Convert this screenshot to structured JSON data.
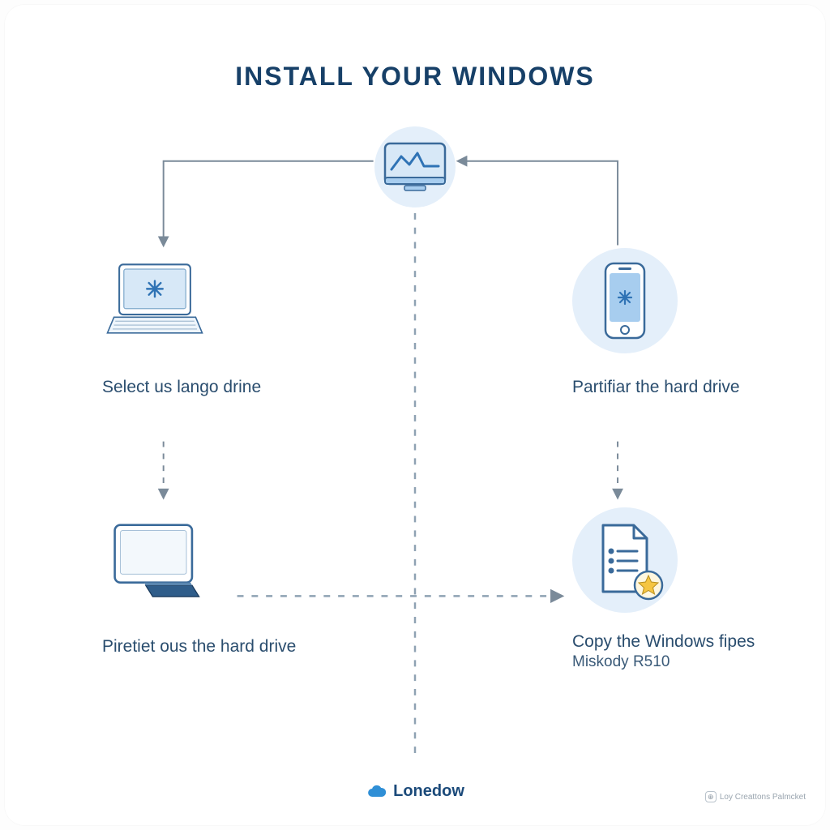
{
  "title": "INSTALL YOUR WINDOWS",
  "nodes": {
    "top": {
      "icon": "monitor-graph-icon"
    },
    "left": {
      "icon": "laptop-icon",
      "caption": "Select us lango drine"
    },
    "right": {
      "icon": "phone-icon",
      "caption": "Partifiar the hard drive"
    },
    "bl": {
      "icon": "tablet-icon",
      "caption": "Piretiet ous the hard drive"
    },
    "br": {
      "icon": "file-star-icon",
      "caption": "Copy the Windows fipes",
      "sub": "Miskody R510"
    }
  },
  "brand": {
    "name": "Lonedow",
    "icon": "cloud-icon"
  },
  "watermark": "Loy Creattons Palmcket",
  "colors": {
    "primary": "#174068",
    "accent": "#2f73b5",
    "circle": "#e4effa",
    "lightblue": "#a7cdef",
    "star": "#f5c542"
  }
}
